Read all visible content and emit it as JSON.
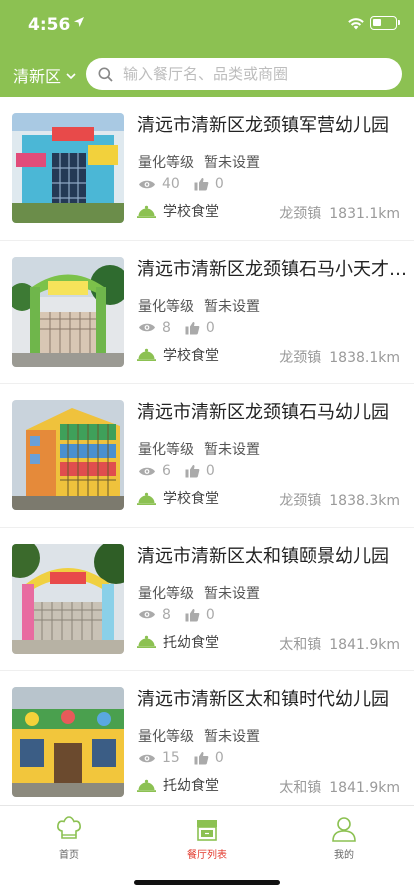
{
  "status_bar": {
    "time": "4:56"
  },
  "header": {
    "district": "清新区",
    "search_placeholder": "输入餐厅名、品类或商圈"
  },
  "restaurants": [
    {
      "name": "清远市清新区龙颈镇军营幼儿园",
      "grade_label": "量化等级",
      "grade_value": "暂未设置",
      "views": "40",
      "likes": "0",
      "category": "学校食堂",
      "town": "龙颈镇",
      "distance": "1831.1km"
    },
    {
      "name": "清远市清新区龙颈镇石马小天才幼儿园",
      "grade_label": "量化等级",
      "grade_value": "暂未设置",
      "views": "8",
      "likes": "0",
      "category": "学校食堂",
      "town": "龙颈镇",
      "distance": "1838.1km"
    },
    {
      "name": "清远市清新区龙颈镇石马幼儿园",
      "grade_label": "量化等级",
      "grade_value": "暂未设置",
      "views": "6",
      "likes": "0",
      "category": "学校食堂",
      "town": "龙颈镇",
      "distance": "1838.3km"
    },
    {
      "name": "清远市清新区太和镇颐景幼儿园",
      "grade_label": "量化等级",
      "grade_value": "暂未设置",
      "views": "8",
      "likes": "0",
      "category": "托幼食堂",
      "town": "太和镇",
      "distance": "1841.9km"
    },
    {
      "name": "清远市清新区太和镇时代幼儿园",
      "grade_label": "量化等级",
      "grade_value": "暂未设置",
      "views": "15",
      "likes": "0",
      "category": "托幼食堂",
      "town": "太和镇",
      "distance": "1841.9km"
    }
  ],
  "tabbar": {
    "home": "首页",
    "list": "餐厅列表",
    "mine": "我的"
  },
  "colors": {
    "brand_green": "#8cc152",
    "active_red": "#e23a2e"
  }
}
